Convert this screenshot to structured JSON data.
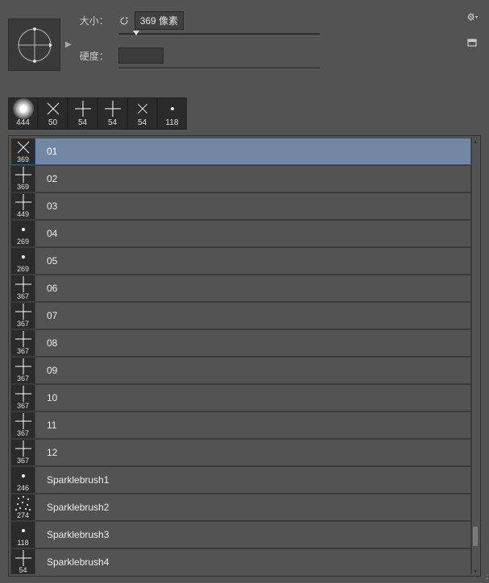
{
  "header": {
    "size_label": "大小：",
    "size_value": "369 像素",
    "hardness_label": "硬度：",
    "hardness_value": ""
  },
  "brush_strip": [
    {
      "size": "444",
      "kind": "soft"
    },
    {
      "size": "50",
      "kind": "star"
    },
    {
      "size": "54",
      "kind": "plus"
    },
    {
      "size": "54",
      "kind": "plus"
    },
    {
      "size": "54",
      "kind": "x"
    },
    {
      "size": "118",
      "kind": "dot"
    }
  ],
  "brushes": [
    {
      "size": "369",
      "name": "01",
      "thumb": "star"
    },
    {
      "size": "369",
      "name": "02",
      "thumb": "plus"
    },
    {
      "size": "449",
      "name": "03",
      "thumb": "plus"
    },
    {
      "size": "269",
      "name": "04",
      "thumb": "dot"
    },
    {
      "size": "269",
      "name": "05",
      "thumb": "dot"
    },
    {
      "size": "367",
      "name": "06",
      "thumb": "plus"
    },
    {
      "size": "367",
      "name": "07",
      "thumb": "plus"
    },
    {
      "size": "367",
      "name": "08",
      "thumb": "plus"
    },
    {
      "size": "367",
      "name": "09",
      "thumb": "plus"
    },
    {
      "size": "367",
      "name": "10",
      "thumb": "plus"
    },
    {
      "size": "367",
      "name": "11",
      "thumb": "plus"
    },
    {
      "size": "367",
      "name": "12",
      "thumb": "plus"
    },
    {
      "size": "246",
      "name": "Sparklebrush1",
      "thumb": "dot"
    },
    {
      "size": "274",
      "name": "Sparklebrush2",
      "thumb": "cluster"
    },
    {
      "size": "118",
      "name": "Sparklebrush3",
      "thumb": "dot"
    },
    {
      "size": "54",
      "name": "Sparklebrush4",
      "thumb": "plus"
    }
  ],
  "selected_index": 0
}
